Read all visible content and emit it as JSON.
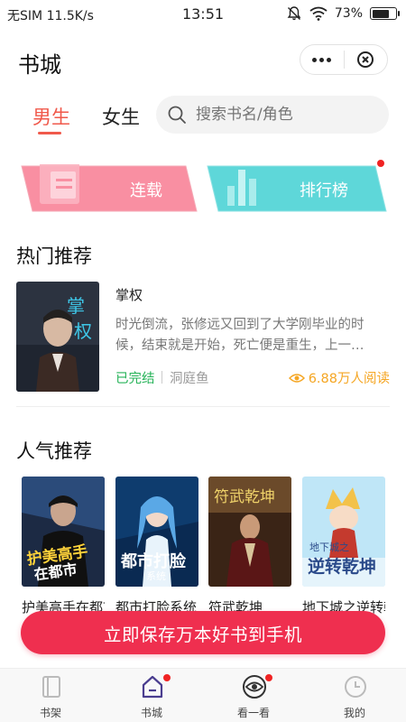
{
  "status_bar": {
    "carrier": "无SIM",
    "net_speed": "11.5K/s",
    "time": "13:51",
    "battery": "73%",
    "battery_level": 0.73
  },
  "header": {
    "title": "书城",
    "more_icon": "more-dots-icon",
    "close_icon": "close-circle-icon"
  },
  "gender_tabs": {
    "male": "男生",
    "female": "女生",
    "active": "男生",
    "accent": "#f0594b"
  },
  "search": {
    "placeholder": "搜索书名/角色",
    "icon": "search-icon"
  },
  "banners": {
    "serial": "连载",
    "ranking": "排行榜",
    "serial_color": "#f78da0",
    "ranking_color": "#5cd6d8"
  },
  "hot": {
    "section_title": "热门推荐",
    "book": {
      "title": "掌权",
      "description": "时光倒流，张修远又回到了大学刚毕业的时候，结束就是开始，死亡便是重生，上一…",
      "status": "已完结",
      "author": "洞庭鱼",
      "reads": "6.88万人阅读"
    }
  },
  "popular": {
    "section_title": "人气推荐",
    "books": [
      {
        "title": "护美高手在都市"
      },
      {
        "title": "都市打脸系统"
      },
      {
        "title": "符武乾坤"
      },
      {
        "title": "地下城之逆转乾坤"
      }
    ]
  },
  "cta": {
    "label": "立即保存万本好书到手机",
    "color": "#ef2f4f"
  },
  "tab_bar": {
    "tabs": [
      {
        "label": "书架",
        "icon": "bookshelf-icon"
      },
      {
        "label": "书城",
        "icon": "bookstore-icon"
      },
      {
        "label": "看一看",
        "icon": "eye-icon"
      },
      {
        "label": "我的",
        "icon": "profile-icon"
      }
    ],
    "active": "书城"
  }
}
